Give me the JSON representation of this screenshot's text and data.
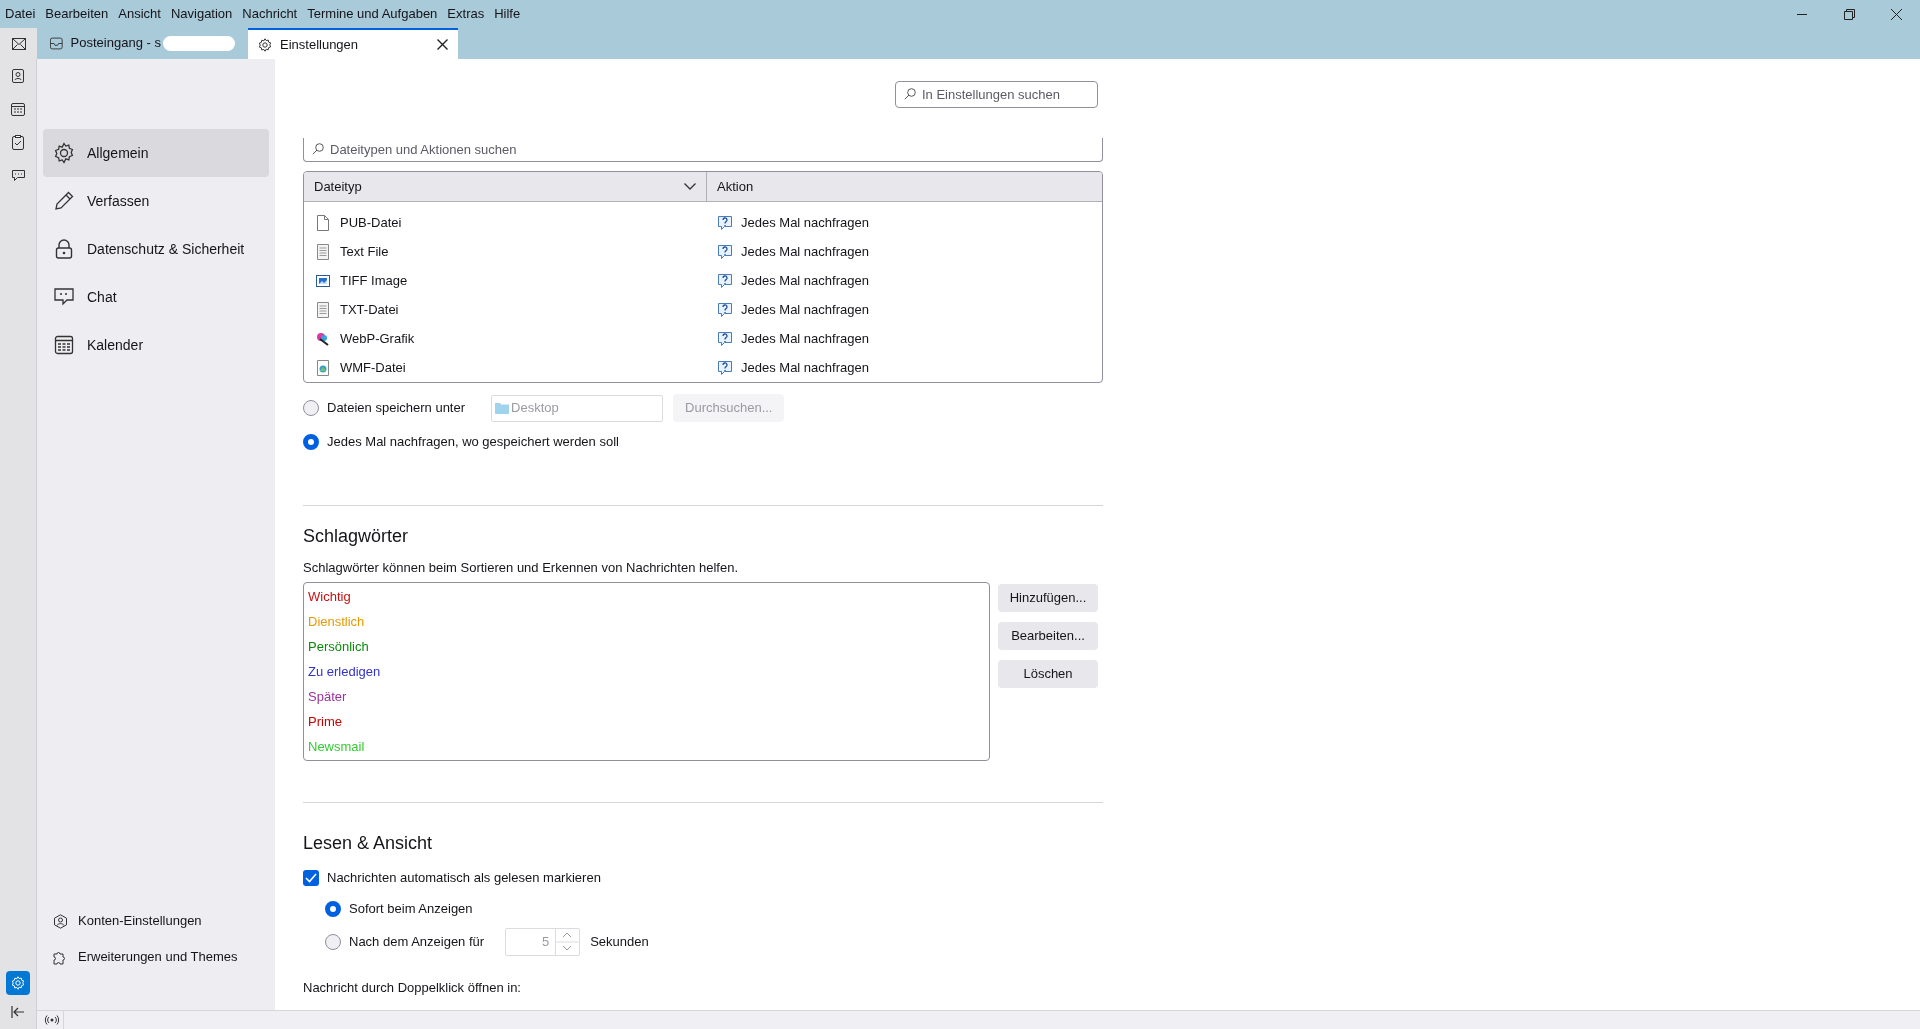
{
  "menu": [
    "Datei",
    "Bearbeiten",
    "Ansicht",
    "Navigation",
    "Nachricht",
    "Termine und Aufgaben",
    "Extras",
    "Hilfe"
  ],
  "tabs": [
    {
      "label": "Posteingang - s",
      "selected": false,
      "obscured": true
    },
    {
      "label": "Einstellungen",
      "selected": true,
      "obscured": false
    }
  ],
  "spaces_toolbar": {
    "settings_selected": true
  },
  "sidebar": {
    "items": [
      {
        "label": "Allgemein",
        "selected": true
      },
      {
        "label": "Verfassen",
        "selected": false
      },
      {
        "label": "Datenschutz & Sicherheit",
        "selected": false
      },
      {
        "label": "Chat",
        "selected": false
      },
      {
        "label": "Kalender",
        "selected": false
      }
    ],
    "footer_links": [
      "Konten-Einstellungen",
      "Erweiterungen und Themes"
    ]
  },
  "search": {
    "placeholder": "In Einstellungen suchen"
  },
  "file_types": {
    "search_placeholder": "Dateitypen und Aktionen suchen",
    "columns": [
      "Dateityp",
      "Aktion"
    ],
    "rows": [
      {
        "type": "PUB-Datei",
        "action": "Jedes Mal nachfragen"
      },
      {
        "type": "Text File",
        "action": "Jedes Mal nachfragen"
      },
      {
        "type": "TIFF Image",
        "action": "Jedes Mal nachfragen"
      },
      {
        "type": "TXT-Datei",
        "action": "Jedes Mal nachfragen"
      },
      {
        "type": "WebP-Grafik",
        "action": "Jedes Mal nachfragen"
      },
      {
        "type": "WMF-Datei",
        "action": "Jedes Mal nachfragen"
      }
    ]
  },
  "download": {
    "options": [
      {
        "label": "Dateien speichern unter",
        "selected": false
      },
      {
        "label": "Jedes Mal nachfragen, wo gespeichert werden soll",
        "selected": true
      }
    ],
    "folder": "Desktop",
    "browse_button": "Durchsuchen...",
    "disabled": true
  },
  "tags": {
    "title": "Schlagwörter",
    "description": "Schlagwörter können beim Sortieren und Erkennen von Nachrichten helfen.",
    "items": [
      {
        "label": "Wichtig",
        "color": "#cc1010"
      },
      {
        "label": "Dienstlich",
        "color": "#e69a00"
      },
      {
        "label": "Persönlich",
        "color": "#0a8a0a"
      },
      {
        "label": "Zu erledigen",
        "color": "#3333cc"
      },
      {
        "label": "Später",
        "color": "#993399"
      },
      {
        "label": "Prime",
        "color": "#cc0000"
      },
      {
        "label": "Newsmail",
        "color": "#33cc33"
      }
    ],
    "buttons": [
      "Hinzufügen...",
      "Bearbeiten...",
      "Löschen"
    ]
  },
  "reading": {
    "title": "Lesen & Ansicht",
    "mark_read": {
      "label": "Nachrichten automatisch als gelesen markieren",
      "checked": true
    },
    "options": [
      {
        "kind": "plain",
        "label": "Sofort beim Anzeigen",
        "selected": true
      },
      {
        "kind": "timed",
        "label": "Nach dem Anzeigen für",
        "selected": false
      }
    ],
    "seconds": {
      "value": "5",
      "unit": "Sekunden",
      "disabled": true
    },
    "open_label": "Nachricht durch Doppelklick öffnen in:"
  }
}
